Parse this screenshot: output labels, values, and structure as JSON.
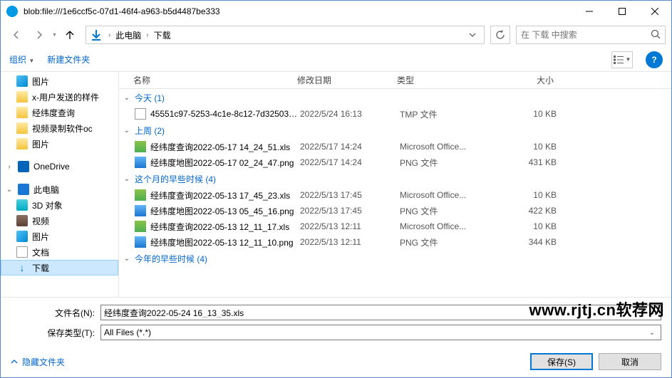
{
  "titlebar": {
    "title": "blob:file:///1e6ccf5c-07d1-46f4-a963-b5d4487be333"
  },
  "breadcrumb": {
    "parts": [
      "此电脑",
      "下载"
    ]
  },
  "search": {
    "placeholder": "在 下载 中搜索"
  },
  "toolbar": {
    "organize": "组织",
    "new_folder": "新建文件夹"
  },
  "sidebar": {
    "items": [
      {
        "label": "图片"
      },
      {
        "label": "x-用户发送的样件"
      },
      {
        "label": "经纬度查询"
      },
      {
        "label": "视频录制软件oc"
      },
      {
        "label": "图片"
      },
      {
        "label": "OneDrive"
      },
      {
        "label": "此电脑"
      },
      {
        "label": "3D 对象"
      },
      {
        "label": "视频"
      },
      {
        "label": "图片"
      },
      {
        "label": "文档"
      },
      {
        "label": "下载"
      }
    ]
  },
  "columns": {
    "name": "名称",
    "date": "修改日期",
    "type": "类型",
    "size": "大小"
  },
  "groups": [
    {
      "title": "今天 (1)",
      "files": [
        {
          "name": "45551c97-5253-4c1e-8c12-7d325038...",
          "date": "2022/5/24 16:13",
          "type": "TMP 文件",
          "size": "10 KB",
          "ic": "generic"
        }
      ]
    },
    {
      "title": "上周 (2)",
      "files": [
        {
          "name": "经纬度查询2022-05-17 14_24_51.xls",
          "date": "2022/5/17 14:24",
          "type": "Microsoft Office...",
          "size": "10 KB",
          "ic": "xls"
        },
        {
          "name": "经纬度地图2022-05-17 02_24_47.png",
          "date": "2022/5/17 14:24",
          "type": "PNG 文件",
          "size": "431 KB",
          "ic": "png"
        }
      ]
    },
    {
      "title": "这个月的早些时候 (4)",
      "files": [
        {
          "name": "经纬度查询2022-05-13 17_45_23.xls",
          "date": "2022/5/13 17:45",
          "type": "Microsoft Office...",
          "size": "10 KB",
          "ic": "xls"
        },
        {
          "name": "经纬度地图2022-05-13 05_45_16.png",
          "date": "2022/5/13 17:45",
          "type": "PNG 文件",
          "size": "422 KB",
          "ic": "png"
        },
        {
          "name": "经纬度查询2022-05-13 12_11_17.xls",
          "date": "2022/5/13 12:11",
          "type": "Microsoft Office...",
          "size": "10 KB",
          "ic": "xls"
        },
        {
          "name": "经纬度地图2022-05-13 12_11_10.png",
          "date": "2022/5/13 12:11",
          "type": "PNG 文件",
          "size": "344 KB",
          "ic": "png"
        }
      ]
    },
    {
      "title": "今年的早些时候 (4)",
      "files": []
    }
  ],
  "fields": {
    "filename_label": "文件名(N):",
    "filename_value": "经纬度查询2022-05-24 16_13_35.xls",
    "filetype_label": "保存类型(T):",
    "filetype_value": "All Files (*.*)"
  },
  "footer": {
    "hide_folders": "隐藏文件夹",
    "save": "保存(S)",
    "cancel": "取消"
  },
  "watermark": "www.rjtj.cn软荐网"
}
